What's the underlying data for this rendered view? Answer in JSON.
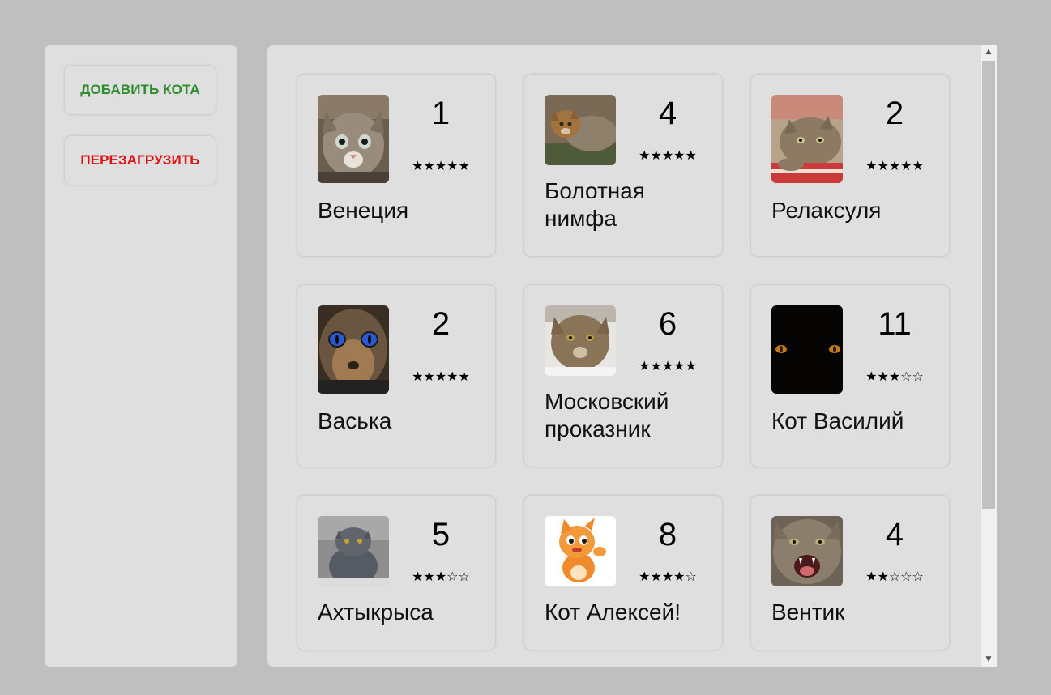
{
  "sidebar": {
    "add_label": "ДОБАВИТЬ КОТА",
    "reload_label": "ПЕРЕЗАГРУЗИТЬ"
  },
  "colors": {
    "add": "#2e8b2e",
    "reload": "#e01010",
    "panel": "#dfdfdf",
    "page": "#bfbfbf"
  },
  "cats": [
    {
      "name": "Венеция",
      "rating": "1",
      "stars": "★★★★★",
      "photo": "tabby-kitten-photo"
    },
    {
      "name": "Болотная нимфа",
      "rating": "4",
      "stars": "★★★★★",
      "photo": "wild-cat-photo"
    },
    {
      "name": "Релаксуля",
      "rating": "2",
      "stars": "★★★★★",
      "photo": "relaxed-tabby-photo"
    },
    {
      "name": "Васька",
      "rating": "2",
      "stars": "★★★★★",
      "photo": "blue-eyed-cat-photo"
    },
    {
      "name": "Московский проказник",
      "rating": "6",
      "stars": "★★★★★",
      "photo": "forest-cat-photo"
    },
    {
      "name": "Кот Василий",
      "rating": "11",
      "stars": "★★★☆☆",
      "photo": "eyes-in-dark-photo"
    },
    {
      "name": "Ахтыкрыса",
      "rating": "5",
      "stars": "★★★☆☆",
      "photo": "british-gray-cat-photo"
    },
    {
      "name": "Кот Алексей!",
      "rating": "8",
      "stars": "★★★★☆",
      "photo": "cartoon-kitten-photo"
    },
    {
      "name": "Вентик",
      "rating": "4",
      "stars": "★★☆☆☆",
      "photo": "hissing-cat-photo"
    }
  ]
}
